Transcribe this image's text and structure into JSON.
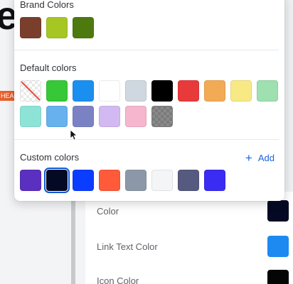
{
  "background": {
    "tag_text": "HEA",
    "properties": [
      {
        "label": "Color",
        "swatch": "#050a24"
      },
      {
        "label": "Link Text Color",
        "swatch": "#1c8af0"
      },
      {
        "label": "Icon Color",
        "swatch": "#050505"
      }
    ]
  },
  "picker": {
    "brand": {
      "title": "Brand Colors",
      "colors": [
        "#7a3f2c",
        "#a6c624",
        "#4d7a0e"
      ]
    },
    "default": {
      "title": "Default colors",
      "row1": [
        "none",
        "#36c837",
        "#1b8ff0",
        "#ffffff",
        "#cfd8e1",
        "#000000",
        "#e83a3a",
        "#f2aa55",
        "#f8e985",
        "#9ee0af"
      ],
      "row2": [
        "#8de3d6",
        "#66b1ee",
        "#7b82c4",
        "#d2b9f2",
        "#f6b6cd",
        "transparent"
      ]
    },
    "custom": {
      "title": "Custom colors",
      "add_label": "Add",
      "colors": [
        "#5b2fbf",
        "#050a24",
        "#0a3dff",
        "#ff5a3a",
        "#8c98a8",
        "#f4f5f7",
        "#565a7e",
        "#3a2cf2"
      ],
      "selected_index": 1
    }
  }
}
